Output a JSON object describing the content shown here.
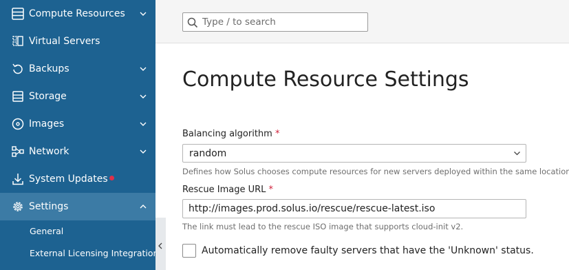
{
  "sidebar": {
    "items": [
      {
        "label": "Compute Resources",
        "icon": "server-list-icon"
      },
      {
        "label": "Virtual Servers",
        "icon": "virtual-server-icon"
      },
      {
        "label": "Backups",
        "icon": "backup-icon"
      },
      {
        "label": "Storage",
        "icon": "storage-icon"
      },
      {
        "label": "Images",
        "icon": "disc-icon"
      },
      {
        "label": "Network",
        "icon": "network-icon"
      },
      {
        "label": "System Updates",
        "icon": "download-icon"
      },
      {
        "label": "Settings",
        "icon": "gear-icon"
      }
    ],
    "sub_items": [
      {
        "label": "General"
      },
      {
        "label": "External Licensing Integrations"
      }
    ]
  },
  "search": {
    "placeholder": "Type / to search"
  },
  "main": {
    "title": "Compute Resource Settings",
    "balancing": {
      "label": "Balancing algorithm",
      "required_mark": "*",
      "value": "random",
      "hint": "Defines how Solus chooses compute resources for new servers deployed within the same location"
    },
    "rescue": {
      "label": "Rescue Image URL",
      "required_mark": "*",
      "value": "http://images.prod.solus.io/rescue/rescue-latest.iso",
      "hint": "The link must lead to the rescue ISO image that supports cloud-init v2."
    },
    "auto_remove": {
      "label": "Automatically remove faulty servers that have the 'Unknown' status."
    }
  },
  "colors": {
    "sidebar_bg": "#1d6291",
    "sidebar_active": "#3c7ba5",
    "required": "#d0213b",
    "update_dot": "#e0304a"
  }
}
